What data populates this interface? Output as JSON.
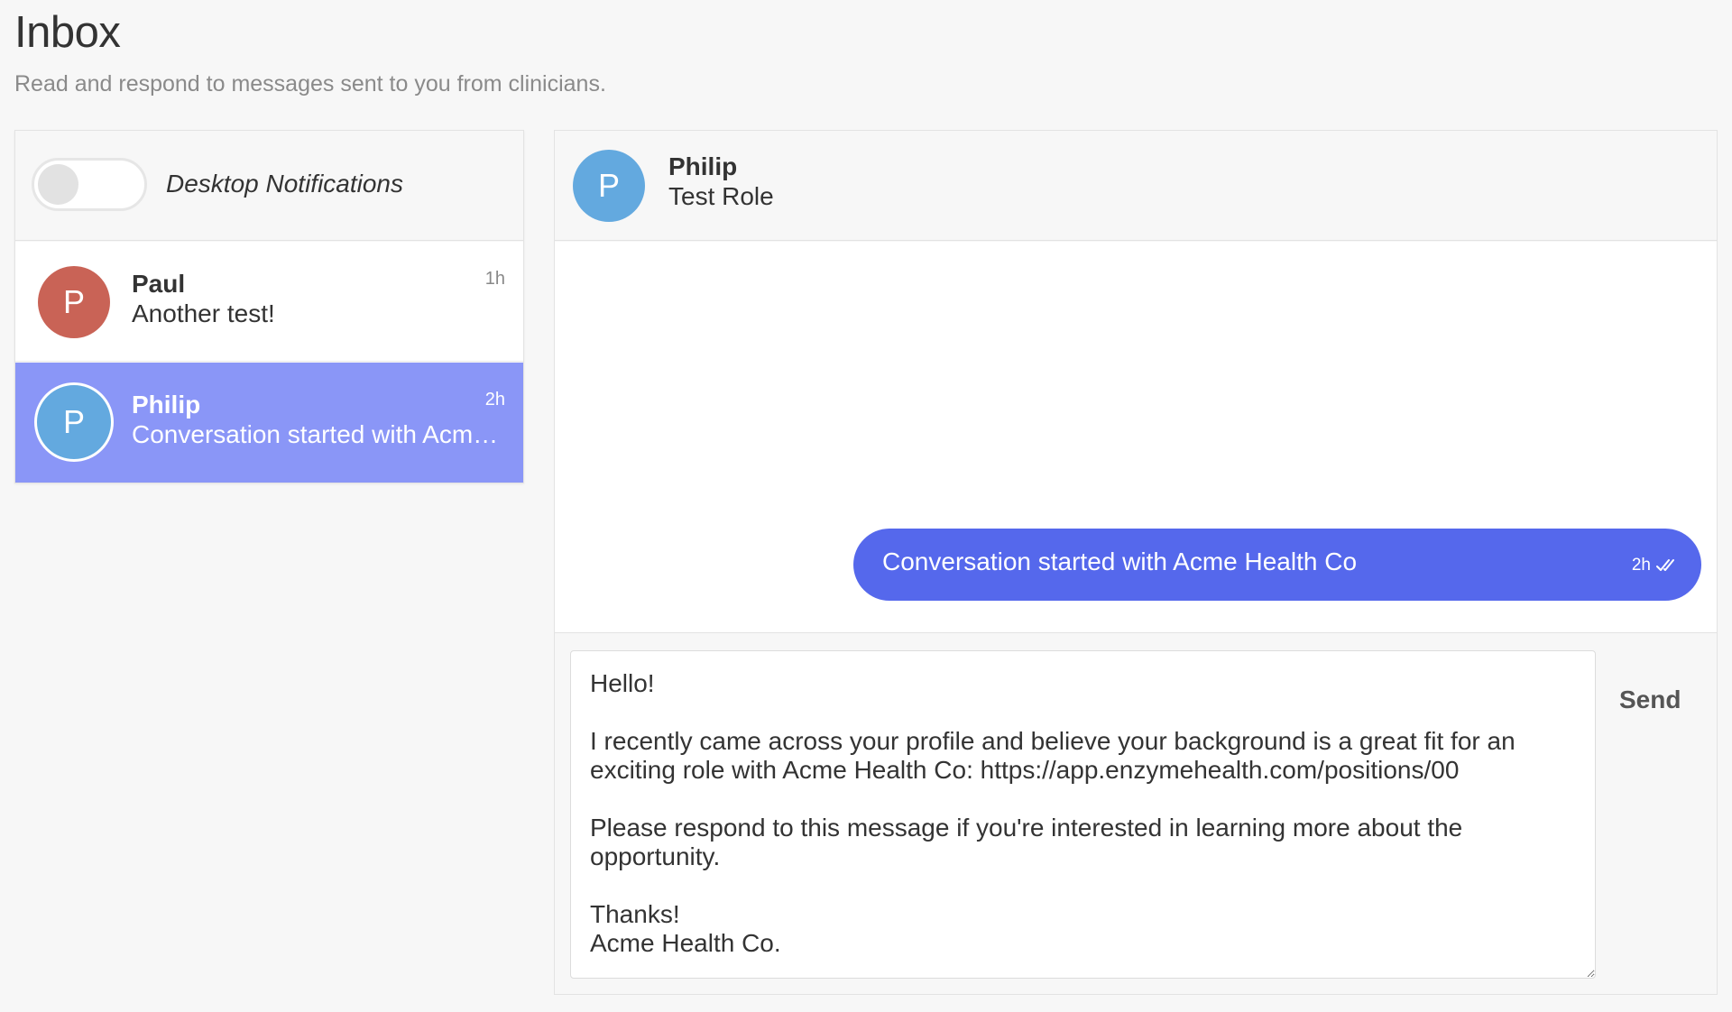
{
  "page": {
    "title": "Inbox",
    "subtitle": "Read and respond to messages sent to you from clinicians."
  },
  "notifications": {
    "label": "Desktop Notifications",
    "enabled": false
  },
  "conversations": [
    {
      "initial": "P",
      "name": "Paul",
      "preview": "Another test!",
      "time": "1h",
      "avatar_color": "#c96356",
      "selected": false
    },
    {
      "initial": "P",
      "name": "Philip",
      "preview": "Conversation started with Acme Health Co",
      "time": "2h",
      "avatar_color": "#63a9df",
      "selected": true
    }
  ],
  "chat": {
    "header": {
      "initial": "P",
      "name": "Philip",
      "role": "Test Role"
    },
    "messages": [
      {
        "text": "Conversation started with Acme Health Co",
        "time": "2h",
        "status_icon": "double-check-icon",
        "color": "#5568ec"
      }
    ],
    "composer_value": "Hello!\n\nI recently came across your profile and believe your background is a great fit for an exciting role with Acme Health Co: https://app.enzymehealth.com/positions/00\n\nPlease respond to this message if you're interested in learning more about the opportunity.\n\nThanks!\nAcme Health Co.",
    "send_label": "Send"
  },
  "colors": {
    "selected_row": "#8a96f7",
    "bubble": "#5568ec"
  }
}
